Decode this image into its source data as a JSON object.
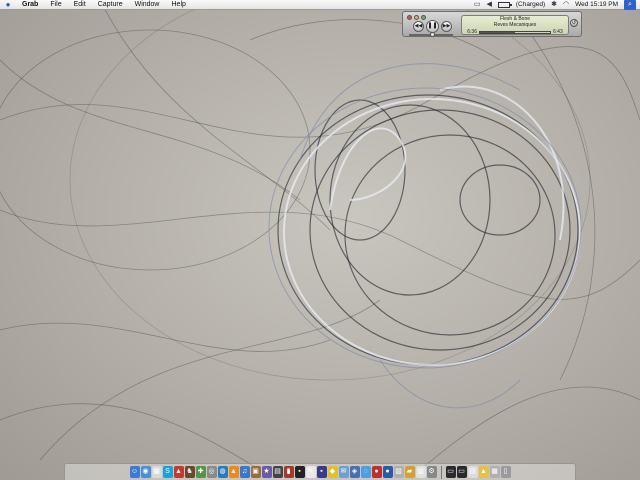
{
  "menubar": {
    "app_name": "Grab",
    "menus": [
      "File",
      "Edit",
      "Capture",
      "Window",
      "Help"
    ],
    "battery_status": "(Charged)",
    "clock": "Wed 15:19 PM"
  },
  "miniplayer": {
    "track_title": "Flesh & Bone",
    "track_artist": "Reves Mecaniques",
    "elapsed": "6:36",
    "remaining": "6:43",
    "progress": 0.5,
    "volume": 0.55
  },
  "dock": {
    "icons": [
      {
        "name": "finder-icon",
        "color": "#3d7ad6",
        "glyph": "☺"
      },
      {
        "name": "safari-icon",
        "color": "#4a8fd8",
        "glyph": "◉"
      },
      {
        "name": "ical-icon",
        "color": "#d9d9d9",
        "glyph": "▦"
      },
      {
        "name": "skype-icon",
        "color": "#1aa2e0",
        "glyph": "S"
      },
      {
        "name": "flag-icon",
        "color": "#c43a2f",
        "glyph": "▲"
      },
      {
        "name": "chess-icon",
        "color": "#6b4a2b",
        "glyph": "♞"
      },
      {
        "name": "xcode-icon",
        "color": "#58934a",
        "glyph": "✚"
      },
      {
        "name": "disk-utility-icon",
        "color": "#8a8a8a",
        "glyph": "◎"
      },
      {
        "name": "globe-icon",
        "color": "#2c7ab8",
        "glyph": "◍"
      },
      {
        "name": "vlc-icon",
        "color": "#ef8a1a",
        "glyph": "▲"
      },
      {
        "name": "itunes-icon",
        "color": "#3a78c8",
        "glyph": "♫"
      },
      {
        "name": "photo-icon",
        "color": "#9a6c3a",
        "glyph": "▣"
      },
      {
        "name": "imovie-icon",
        "color": "#6b5aa8",
        "glyph": "★"
      },
      {
        "name": "film-icon",
        "color": "#444444",
        "glyph": "▤"
      },
      {
        "name": "book-icon",
        "color": "#a43a2c",
        "glyph": "▮"
      },
      {
        "name": "terminal-icon",
        "color": "#222222",
        "glyph": "▪"
      },
      {
        "name": "textedit-icon",
        "color": "#e8e8e8",
        "glyph": "✎"
      },
      {
        "name": "utility-icon",
        "color": "#3a3a8a",
        "glyph": "▪"
      },
      {
        "name": "adium-icon",
        "color": "#e0c030",
        "glyph": "◆"
      },
      {
        "name": "mail-icon",
        "color": "#6f9fd0",
        "glyph": "✉"
      },
      {
        "name": "network-icon",
        "color": "#4a6fb0",
        "glyph": "◈"
      },
      {
        "name": "ichat-icon",
        "color": "#4aa0e0",
        "glyph": "◌"
      },
      {
        "name": "app-icon-red",
        "color": "#c0302a",
        "glyph": "●"
      },
      {
        "name": "app-icon-blue",
        "color": "#2a5aa8",
        "glyph": "●"
      },
      {
        "name": "preview-icon",
        "color": "#b0b0b0",
        "glyph": "▧"
      },
      {
        "name": "folder-icon",
        "color": "#d8a030",
        "glyph": "▰"
      },
      {
        "name": "calendar-icon",
        "color": "#e0e0e0",
        "glyph": "▥"
      },
      {
        "name": "system-preferences-icon",
        "color": "#888888",
        "glyph": "⚙"
      }
    ],
    "right_icons": [
      {
        "name": "window-thumb-icon",
        "color": "#2a2a2a",
        "glyph": "▭"
      },
      {
        "name": "window-thumb-icon-2",
        "color": "#2a2a2a",
        "glyph": "▭"
      },
      {
        "name": "screenshot-doc-icon",
        "color": "#dcdcdc",
        "glyph": "▤"
      },
      {
        "name": "stack-icon",
        "color": "#e6c04a",
        "glyph": "▲"
      },
      {
        "name": "downloads-folder-icon",
        "color": "#b0b0b0",
        "glyph": "▦"
      },
      {
        "name": "trash-icon",
        "color": "#9a9a9a",
        "glyph": "▯"
      }
    ]
  }
}
